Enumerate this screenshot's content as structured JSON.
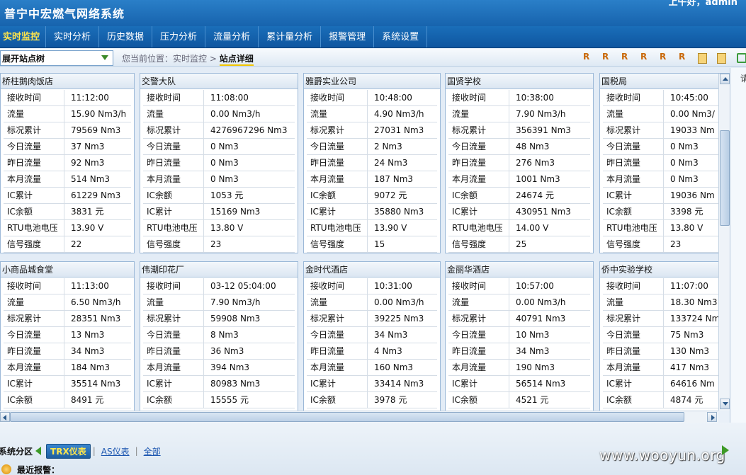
{
  "app": {
    "title": "普宁中宏燃气网络系统",
    "greeting": "上午好，admin"
  },
  "nav": [
    {
      "label": "实时监控",
      "active": true
    },
    {
      "label": "实时分析"
    },
    {
      "label": "历史数据"
    },
    {
      "label": "压力分析"
    },
    {
      "label": "流量分析"
    },
    {
      "label": "累计量分析"
    },
    {
      "label": "报警管理"
    },
    {
      "label": "系统设置"
    }
  ],
  "toolbar": {
    "tree_toggle": "展开站点树",
    "crumb_prefix": "您当前位置：实时监控 >",
    "crumb_current": "站点详细"
  },
  "side_panel": {
    "label": "请"
  },
  "stations": [
    {
      "name": "桥柱鹅肉饭店",
      "rows": [
        [
          "接收时间",
          "11:12:00"
        ],
        [
          "流量",
          "15.90 Nm3/h"
        ],
        [
          "标况累计",
          "79569 Nm3"
        ],
        [
          "今日流量",
          "37 Nm3"
        ],
        [
          "昨日流量",
          "92 Nm3"
        ],
        [
          "本月流量",
          "514 Nm3"
        ],
        [
          "IC累计",
          "61229 Nm3"
        ],
        [
          "IC余额",
          "3831 元"
        ],
        [
          "RTU电池电压",
          "13.90 V"
        ],
        [
          "信号强度",
          "22"
        ]
      ]
    },
    {
      "name": "交警大队",
      "rows": [
        [
          "接收时间",
          "11:08:00"
        ],
        [
          "流量",
          "0.00 Nm3/h"
        ],
        [
          "标况累计",
          "4276967296 Nm3"
        ],
        [
          "今日流量",
          "0 Nm3"
        ],
        [
          "昨日流量",
          "0 Nm3"
        ],
        [
          "本月流量",
          "0 Nm3"
        ],
        [
          "IC余额",
          "1053 元"
        ],
        [
          "IC累计",
          "15169 Nm3"
        ],
        [
          "RTU电池电压",
          "13.80 V"
        ],
        [
          "信号强度",
          "23"
        ]
      ]
    },
    {
      "name": "雅爵实业公司",
      "rows": [
        [
          "接收时间",
          "10:48:00"
        ],
        [
          "流量",
          "4.90 Nm3/h"
        ],
        [
          "标况累计",
          "27031 Nm3"
        ],
        [
          "今日流量",
          "2 Nm3"
        ],
        [
          "昨日流量",
          "24 Nm3"
        ],
        [
          "本月流量",
          "187 Nm3"
        ],
        [
          "IC余额",
          "9072 元"
        ],
        [
          "IC累计",
          "35880 Nm3"
        ],
        [
          "RTU电池电压",
          "13.90 V"
        ],
        [
          "信号强度",
          "15"
        ]
      ]
    },
    {
      "name": "国贤学校",
      "rows": [
        [
          "接收时间",
          "10:38:00"
        ],
        [
          "流量",
          "7.90 Nm3/h"
        ],
        [
          "标况累计",
          "356391 Nm3"
        ],
        [
          "今日流量",
          "48 Nm3"
        ],
        [
          "昨日流量",
          "276 Nm3"
        ],
        [
          "本月流量",
          "1001 Nm3"
        ],
        [
          "IC余额",
          "24674 元"
        ],
        [
          "IC累计",
          "430951 Nm3"
        ],
        [
          "RTU电池电压",
          "14.00 V"
        ],
        [
          "信号强度",
          "25"
        ]
      ]
    },
    {
      "name": "国税局",
      "rows": [
        [
          "接收时间",
          "10:45:00"
        ],
        [
          "流量",
          "0.00 Nm3/"
        ],
        [
          "标况累计",
          "19033 Nm"
        ],
        [
          "今日流量",
          "0 Nm3"
        ],
        [
          "昨日流量",
          "0 Nm3"
        ],
        [
          "本月流量",
          "0 Nm3"
        ],
        [
          "IC累计",
          "19036 Nm"
        ],
        [
          "IC余额",
          "3398 元"
        ],
        [
          "RTU电池电压",
          "13.80 V"
        ],
        [
          "信号强度",
          "23"
        ]
      ]
    },
    {
      "name": "小商品城食堂",
      "rows": [
        [
          "接收时间",
          "11:13:00"
        ],
        [
          "流量",
          "6.50 Nm3/h"
        ],
        [
          "标况累计",
          "28351 Nm3"
        ],
        [
          "今日流量",
          "13 Nm3"
        ],
        [
          "昨日流量",
          "34 Nm3"
        ],
        [
          "本月流量",
          "184 Nm3"
        ],
        [
          "IC累计",
          "35514 Nm3"
        ],
        [
          "IC余额",
          "8491 元"
        ]
      ]
    },
    {
      "name": "伟潮印花厂",
      "rows": [
        [
          "接收时间",
          "03-12 05:04:00"
        ],
        [
          "流量",
          "7.90 Nm3/h"
        ],
        [
          "标况累计",
          "59908 Nm3"
        ],
        [
          "今日流量",
          "8 Nm3"
        ],
        [
          "昨日流量",
          "36 Nm3"
        ],
        [
          "本月流量",
          "394 Nm3"
        ],
        [
          "IC累计",
          "80983 Nm3"
        ],
        [
          "IC余额",
          "15555 元"
        ]
      ]
    },
    {
      "name": "金时代酒店",
      "rows": [
        [
          "接收时间",
          "10:31:00"
        ],
        [
          "流量",
          "0.00 Nm3/h"
        ],
        [
          "标况累计",
          "39225 Nm3"
        ],
        [
          "今日流量",
          "34 Nm3"
        ],
        [
          "昨日流量",
          "4 Nm3"
        ],
        [
          "本月流量",
          "160 Nm3"
        ],
        [
          "IC累计",
          "33414 Nm3"
        ],
        [
          "IC余额",
          "3978 元"
        ]
      ]
    },
    {
      "name": "金丽华酒店",
      "rows": [
        [
          "接收时间",
          "10:57:00"
        ],
        [
          "流量",
          "0.00 Nm3/h"
        ],
        [
          "标况累计",
          "40791 Nm3"
        ],
        [
          "今日流量",
          "10 Nm3"
        ],
        [
          "昨日流量",
          "34 Nm3"
        ],
        [
          "本月流量",
          "190 Nm3"
        ],
        [
          "IC累计",
          "56514 Nm3"
        ],
        [
          "IC余额",
          "4521 元"
        ]
      ]
    },
    {
      "name": "侨中实验学校",
      "rows": [
        [
          "接收时间",
          "11:07:00"
        ],
        [
          "流量",
          "18.30 Nm3"
        ],
        [
          "标况累计",
          "133724 Nm"
        ],
        [
          "今日流量",
          "75 Nm3"
        ],
        [
          "昨日流量",
          "130 Nm3"
        ],
        [
          "本月流量",
          "417 Nm3"
        ],
        [
          "IC累计",
          "64616 Nm"
        ],
        [
          "IC余额",
          "4874 元"
        ]
      ]
    }
  ],
  "zone_bar": {
    "label": "系统分区",
    "tabs": [
      {
        "label": "TRX仪表",
        "active": true
      },
      {
        "label": "AS仪表"
      },
      {
        "label": "全部"
      }
    ]
  },
  "alarm": {
    "label": "最近报警："
  },
  "watermark": "www.wooyun.org",
  "icons": {
    "toolbar": [
      "report-icon",
      "query-icon",
      "report-icon",
      "report-icon",
      "report-icon",
      "report-icon",
      "document-icon",
      "document-search-icon",
      "network-icon"
    ]
  }
}
